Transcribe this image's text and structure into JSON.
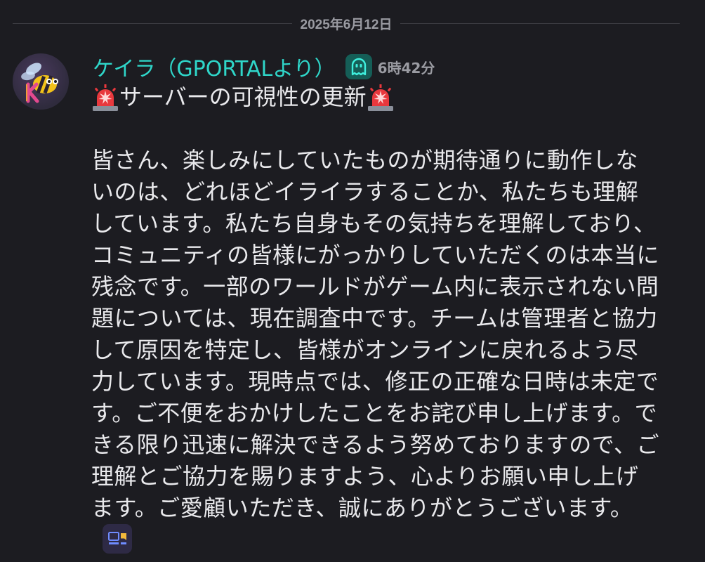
{
  "date_divider": "2025年6月12日",
  "message": {
    "username": "ケイラ（GPORTALより）",
    "timestamp": "6時42分",
    "badge_icon": "ghost-icon",
    "avatar_icon": "bee-avatar",
    "title": "サーバーの可視性の更新",
    "title_emoji": "police-siren-emoji",
    "body": "皆さん、楽しみにしていたものが期待通りに動作しないのは、どれほどイライラすることか、私たちも理解しています。私たち自身もその気持ちを理解しており、コミュニティの皆様にがっかりしていただくのは本当に残念です。一部のワールドがゲーム内に表示されない問題については、現在調査中です。チームは管理者と協力して原因を特定し、皆様がオンラインに戻れるよう尽力しています。現時点では、修正の正確な日時は未定です。ご不便をおかけしたことをお詫び申し上げます。できる限り迅速に解決できるよう努めておりますので、ご理解とご協力を賜りますよう、心よりお願い申し上げます。ご愛顧いただき、誠にありがとうございます。",
    "trailing_icon": "news-icon"
  },
  "colors": {
    "background": "#1c1c21",
    "username": "#2fd6c9",
    "text": "#e9e9ec",
    "muted": "#9a9ba2"
  }
}
